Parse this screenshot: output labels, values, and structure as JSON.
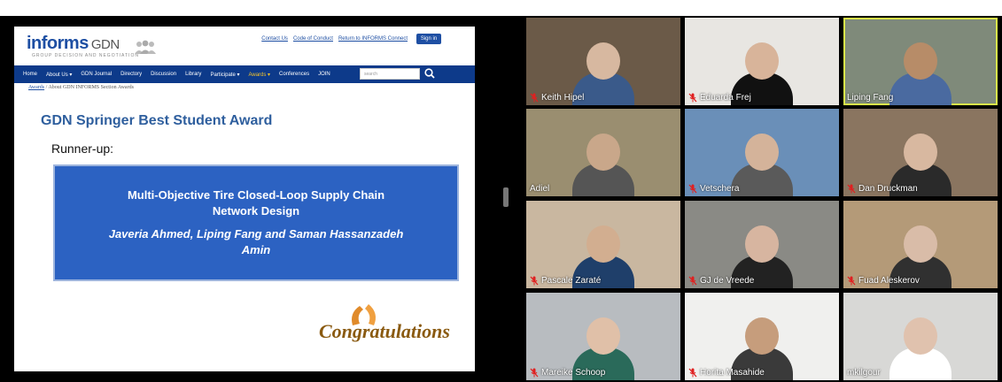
{
  "website": {
    "logo_text": "informs",
    "logo_gdn": "GDN",
    "logo_subtitle": "GROUP DECISION AND NEGOTIATION",
    "top_links": [
      "Contact Us",
      "Code of Conduct",
      "Return to INFORMS Connect"
    ],
    "signin_label": "Sign in",
    "nav_items": [
      "Home",
      "About Us ▾",
      "GDN Journal",
      "Directory",
      "Discussion",
      "Library",
      "Participate ▾",
      "Awards ▾",
      "Conferences",
      "JOIN"
    ],
    "active_nav": "Awards ▾",
    "search_placeholder": "search",
    "breadcrumb": {
      "link": "Awards",
      "separator": "/",
      "current": "About GDN INFORMS Section Awards"
    }
  },
  "slide": {
    "title": "GDN Springer Best Student Award",
    "runner_up": "Runner-up:",
    "paper_title_line1": "Multi-Objective Tire Closed-Loop Supply Chain",
    "paper_title_line2": "Network Design",
    "authors_line1": "Javeria Ahmed, Liping Fang and Saman Hassanzadeh",
    "authors_line2": "Amin",
    "congrats": "Congratulations"
  },
  "participants": [
    {
      "name": "Keith Hipel",
      "muted": true,
      "bg": "#6b5a48",
      "skin": "#d7b8a0",
      "shirt": "#3a5a8a"
    },
    {
      "name": "Eduarda Frej",
      "muted": true,
      "bg": "#e8e6e2",
      "skin": "#d8b49a",
      "shirt": "#111111"
    },
    {
      "name": "Liping Fang",
      "muted": false,
      "bg": "#7f8a7a",
      "skin": "#b78c68",
      "shirt": "#4a6aa0"
    },
    {
      "name": "Adiel",
      "muted": false,
      "bg": "#9a8e70",
      "skin": "#c9a78a",
      "shirt": "#555555"
    },
    {
      "name": "Vetschera",
      "muted": true,
      "bg": "#6a8fb8",
      "skin": "#d4b39a",
      "shirt": "#5a5a5a"
    },
    {
      "name": "Dan Druckman",
      "muted": true,
      "bg": "#8a7560",
      "skin": "#d8b8a0",
      "shirt": "#2a2a2a"
    },
    {
      "name": "Pascale Zaraté",
      "muted": true,
      "bg": "#c9b7a0",
      "skin": "#d2ae90",
      "shirt": "#1f3f6a"
    },
    {
      "name": "GJ de Vreede",
      "muted": true,
      "bg": "#8a8a85",
      "skin": "#d7b5a0",
      "shirt": "#222222"
    },
    {
      "name": "Fuad Aleskerov",
      "muted": true,
      "bg": "#b49a78",
      "skin": "#d9bca8",
      "shirt": "#303030"
    },
    {
      "name": "Mareike Schoop",
      "muted": true,
      "bg": "#b8bcc0",
      "skin": "#e0c0a8",
      "shirt": "#2a6a5a"
    },
    {
      "name": "Horita Masahide",
      "muted": true,
      "bg": "#f0f0ee",
      "skin": "#c69d7c",
      "shirt": "#3a3a3a"
    },
    {
      "name": "mkilgour",
      "muted": false,
      "bg": "#d8d8d6",
      "skin": "#e0c2ae",
      "shirt": "#ffffff"
    }
  ],
  "colors": {
    "nav_bg": "#0d3a8a",
    "active_speaker": "#d9e84a",
    "award_box": "#2c62c2",
    "title": "#2f5f9e"
  }
}
